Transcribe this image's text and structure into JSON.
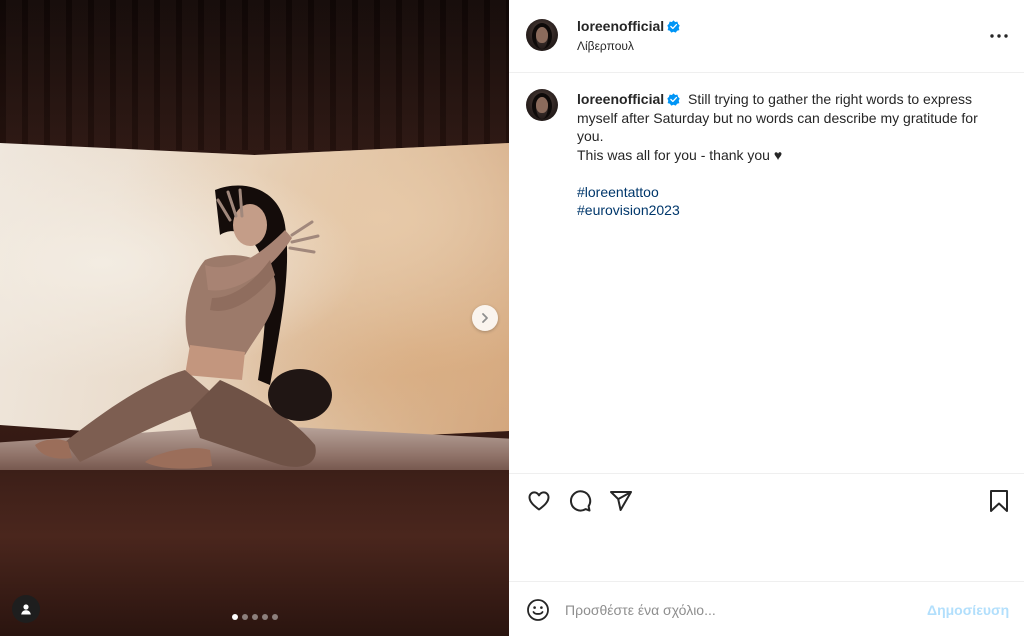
{
  "post": {
    "username": "loreenofficial",
    "location": "Λίβερπουλ",
    "verified": true,
    "caption_lines": [
      "Still trying to gather the right words to express",
      "myself after Saturday but no words can describe my gratitude for",
      "you.",
      "This was all for you - thank you ♥"
    ],
    "hashtags": [
      "#loreentattoo",
      "#eurovision2023"
    ]
  },
  "media": {
    "carousel_count": 5,
    "carousel_active": 1
  },
  "icons": {
    "more": "more-options-icon",
    "like": "heart-icon",
    "comment": "comment-icon",
    "share": "share-icon",
    "save": "bookmark-icon",
    "emoji": "emoji-icon",
    "next": "chevron-right-icon",
    "tagged_user": "user-icon",
    "verified": "verified-badge-icon"
  },
  "comment": {
    "placeholder": "Προσθέστε ένα σχόλιο...",
    "post_label": "Δημοσίευση"
  },
  "colors": {
    "verified": "#0095f6",
    "hashtag": "#00376b",
    "post_disabled": "#b2dffc"
  }
}
